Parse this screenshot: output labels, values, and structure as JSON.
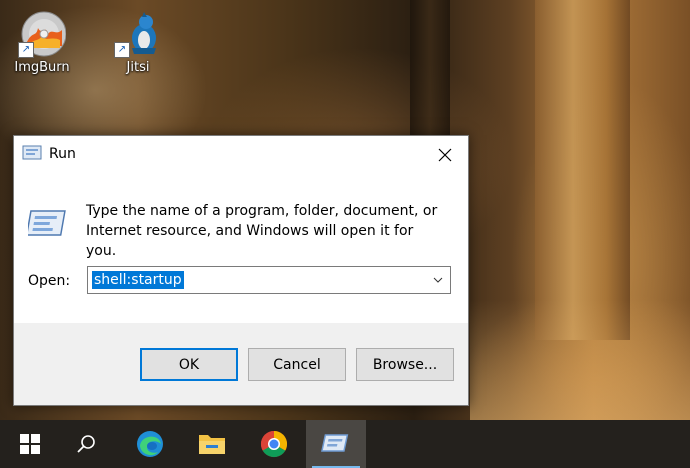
{
  "desktop": {
    "icons": [
      {
        "label": "ImgBurn",
        "icon": "imgburn-icon"
      },
      {
        "label": "Jitsi",
        "icon": "jitsi-icon"
      }
    ]
  },
  "run_dialog": {
    "title": "Run",
    "description": "Type the name of a program, folder, document, or Internet resource, and Windows will open it for you.",
    "open_label": "Open:",
    "open_value": "shell:startup",
    "buttons": {
      "ok": "OK",
      "cancel": "Cancel",
      "browse": "Browse..."
    },
    "colors": {
      "selection": "#0078d7",
      "default_button_border": "#0078d7"
    }
  },
  "taskbar": {
    "items": [
      {
        "name": "start",
        "icon": "windows-logo-icon"
      },
      {
        "name": "search",
        "icon": "search-icon"
      },
      {
        "name": "edge",
        "icon": "edge-icon"
      },
      {
        "name": "file-explorer",
        "icon": "folder-icon"
      },
      {
        "name": "chrome",
        "icon": "chrome-icon"
      },
      {
        "name": "run",
        "icon": "run-icon",
        "active": true
      }
    ]
  }
}
